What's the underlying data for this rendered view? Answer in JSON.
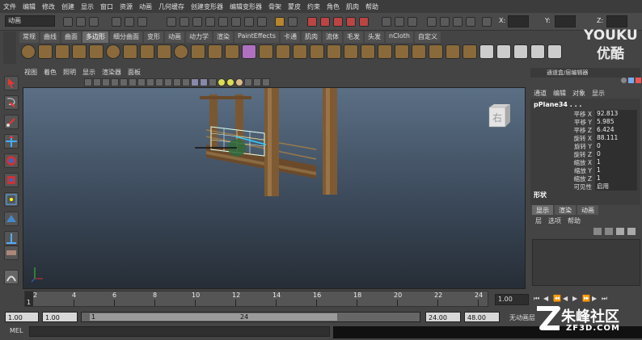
{
  "menubar": {
    "items": [
      "文件",
      "编辑",
      "修改",
      "创建",
      "显示",
      "窗口",
      "资源",
      "动画",
      "几何缓存",
      "创建变形器",
      "编辑变形器",
      "骨架",
      "蒙皮",
      "约束",
      "角色",
      "肌肉",
      "帮助"
    ]
  },
  "statusline": {
    "mode": "动画",
    "x_label": "X:",
    "y_label": "Y:",
    "z_label": "Z:"
  },
  "watermarks": {
    "youku_en": "YOUKU",
    "youku_cn": "优酷",
    "zf3d_cn": "朱峰社区",
    "zf3d_en": "ZF3D.COM"
  },
  "shelf": {
    "tabs": [
      "常规",
      "曲线",
      "曲面",
      "多边形",
      "细分曲面",
      "变形",
      "动画",
      "动力学",
      "渲染",
      "PaintEffects",
      "卡通",
      "肌肉",
      "流体",
      "毛发",
      "头发",
      "nCloth",
      "自定义"
    ],
    "active_tab": "多边形"
  },
  "viewport": {
    "menu": [
      "视图",
      "着色",
      "照明",
      "显示",
      "渲染器",
      "面板"
    ],
    "viewcube_label": "右"
  },
  "channel_box": {
    "header": "通道盒/层编辑器",
    "menu": [
      "通道",
      "编辑",
      "对象",
      "显示"
    ],
    "object_name": "pPlane34 . . .",
    "attributes": [
      {
        "label": "平移 X",
        "value": "92.813"
      },
      {
        "label": "平移 Y",
        "value": "5.985"
      },
      {
        "label": "平移 Z",
        "value": "6.424"
      },
      {
        "label": "旋转 X",
        "value": "88.111"
      },
      {
        "label": "旋转 Y",
        "value": "0"
      },
      {
        "label": "旋转 Z",
        "value": "0"
      },
      {
        "label": "缩放 X",
        "value": "1"
      },
      {
        "label": "缩放 Y",
        "value": "1"
      },
      {
        "label": "缩放 Z",
        "value": "1"
      },
      {
        "label": "可见性",
        "value": "启用"
      }
    ],
    "shape_label": "形状"
  },
  "layer_editor": {
    "tabs": [
      "显示",
      "渲染",
      "动画"
    ],
    "active_tab": "显示",
    "menu": [
      "层",
      "选项",
      "帮助"
    ]
  },
  "timeline": {
    "ticks": [
      "1",
      "2",
      "4",
      "6",
      "8",
      "10",
      "12",
      "14",
      "16",
      "18",
      "20",
      "22",
      "24"
    ],
    "current_time": "1.00"
  },
  "range": {
    "start": "1.00",
    "start2": "1.00",
    "inner_start": "1",
    "inner_end": "24",
    "end": "24.00",
    "end2": "48.00",
    "anim_layer": "无动画层"
  },
  "command_line": {
    "label": "MEL"
  }
}
